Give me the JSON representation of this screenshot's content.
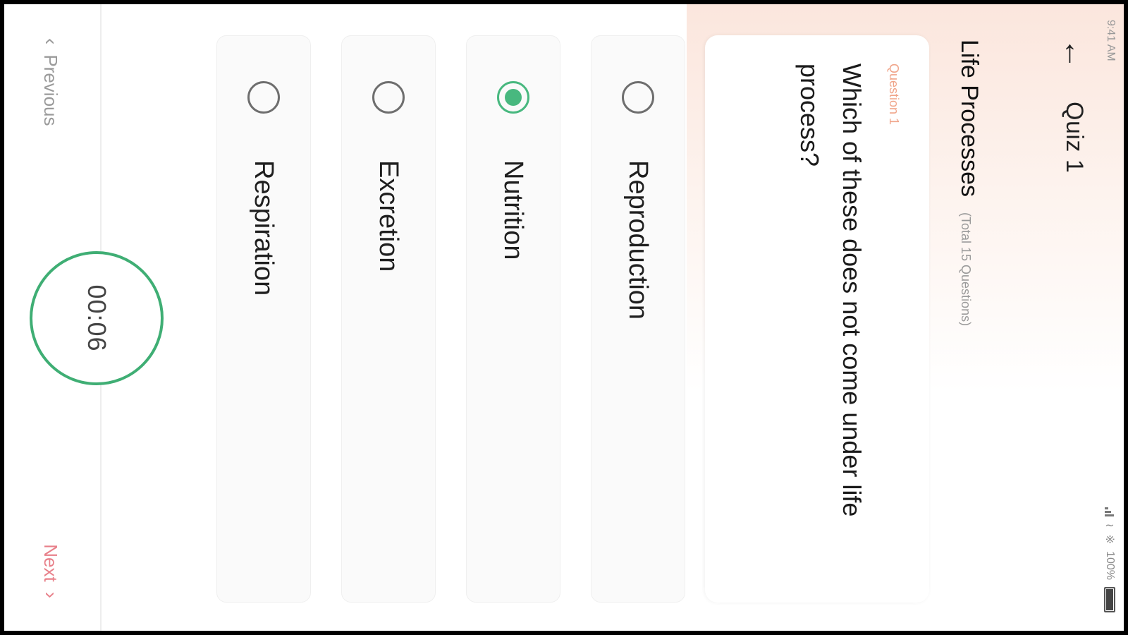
{
  "status_bar": {
    "time": "9:41 AM",
    "battery": "100%",
    "icons": [
      "signal-icon",
      "wifi-icon",
      "bluetooth-icon",
      "battery-icon"
    ]
  },
  "header": {
    "back_icon": "back-arrow-icon",
    "title": "Quiz 1"
  },
  "topic": {
    "title": "Life Processes",
    "subtitle": "(Total 15 Questions)"
  },
  "question": {
    "number_label": "Question 1",
    "text": "Which of these does not come under life process?"
  },
  "options": [
    {
      "label": "Reproduction",
      "selected": false
    },
    {
      "label": "Nutrition",
      "selected": true
    },
    {
      "label": "Excretion",
      "selected": false
    },
    {
      "label": "Respiration",
      "selected": false
    }
  ],
  "footer": {
    "previous_label": "Previous",
    "next_label": "Next",
    "timer": "00:06"
  },
  "colors": {
    "accent_green": "#48b87f",
    "question_label": "#f0a58a",
    "next_link": "#e8808a"
  }
}
